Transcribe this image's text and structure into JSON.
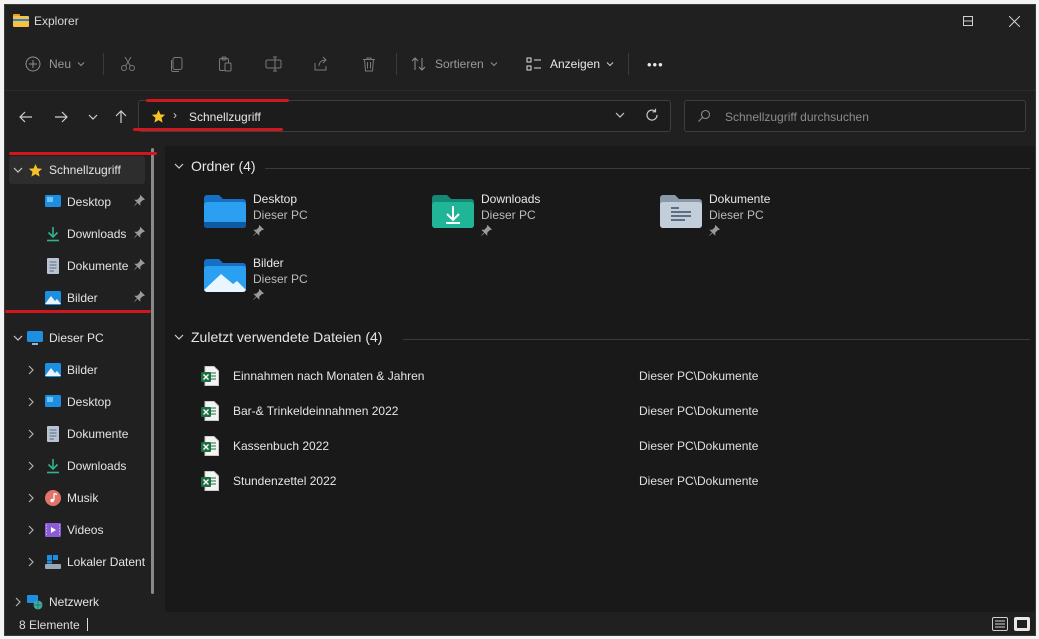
{
  "window": {
    "title": "Explorer",
    "controls": {
      "minimize": "—",
      "maximize": "☐",
      "close": "✕"
    }
  },
  "toolbar": {
    "new_label": "Neu",
    "sort_label": "Sortieren",
    "view_label": "Anzeigen",
    "more_label": "•••"
  },
  "navigation": {
    "address_crumb": "Schnellzugriff",
    "search_placeholder": "Schnellzugriff durchsuchen"
  },
  "sidebar": {
    "quick_access": {
      "label": "Schnellzugriff",
      "items": [
        {
          "label": "Desktop",
          "icon": "desktop-icon"
        },
        {
          "label": "Downloads",
          "icon": "download-icon"
        },
        {
          "label": "Dokumente",
          "icon": "document-icon"
        },
        {
          "label": "Bilder",
          "icon": "pictures-icon"
        }
      ]
    },
    "this_pc": {
      "label": "Dieser PC",
      "items": [
        {
          "label": "Bilder",
          "icon": "pictures-icon"
        },
        {
          "label": "Desktop",
          "icon": "desktop-icon"
        },
        {
          "label": "Dokumente",
          "icon": "document-icon"
        },
        {
          "label": "Downloads",
          "icon": "download-icon"
        },
        {
          "label": "Musik",
          "icon": "music-icon"
        },
        {
          "label": "Videos",
          "icon": "video-icon"
        },
        {
          "label": "Lokaler Datentr",
          "icon": "drive-icon"
        }
      ]
    },
    "network": {
      "label": "Netzwerk"
    }
  },
  "content": {
    "folders_header": "Ordner (4)",
    "folders": [
      {
        "name": "Desktop",
        "location": "Dieser PC",
        "icon": "desktop-folder-icon"
      },
      {
        "name": "Downloads",
        "location": "Dieser PC",
        "icon": "downloads-folder-icon"
      },
      {
        "name": "Dokumente",
        "location": "Dieser PC",
        "icon": "documents-folder-icon"
      },
      {
        "name": "Bilder",
        "location": "Dieser PC",
        "icon": "pictures-folder-icon"
      }
    ],
    "recent_header": "Zuletzt verwendete Dateien (4)",
    "recent_files": [
      {
        "name": "Einnahmen nach Monaten & Jahren",
        "path": "Dieser PC\\Dokumente"
      },
      {
        "name": "Bar-& Trinkeldeinnahmen 2022",
        "path": "Dieser PC\\Dokumente"
      },
      {
        "name": "Kassenbuch 2022",
        "path": "Dieser PC\\Dokumente"
      },
      {
        "name": "Stundenzettel 2022",
        "path": "Dieser PC\\Dokumente"
      }
    ]
  },
  "status": {
    "item_count": "8 Elemente"
  },
  "colors": {
    "window_bg": "#202020",
    "content_bg": "#191919",
    "annotation_red": "#d1161d",
    "excel_green": "#1d6f42",
    "folder_blue": "#1e90e0",
    "folder_teal": "#1fa58f"
  }
}
